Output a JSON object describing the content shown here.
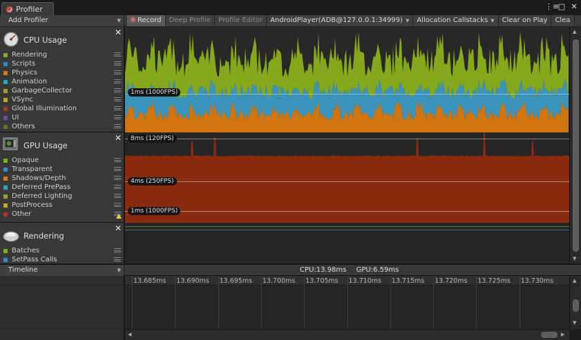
{
  "window": {
    "tab_title": "Profiler",
    "controls": [
      "⋮≡",
      "□",
      "✕"
    ]
  },
  "toolbar": {
    "add_profiler": "Add Profiler",
    "record": "Record",
    "deep_profile": "Deep Profile",
    "profiler_editor": "Profile Editor",
    "target": "AndroidPlayer(ADB@127.0.0.1:34999)",
    "allocation_callstacks": "Allocation Callstacks",
    "clear_on_play": "Clear on Play",
    "clear": "Clea"
  },
  "modules": {
    "cpu": {
      "title": "CPU Usage",
      "items": [
        {
          "label": "Rendering",
          "color": "#7ab317"
        },
        {
          "label": "Scripts",
          "color": "#2a8fc2"
        },
        {
          "label": "Physics",
          "color": "#d67b16"
        },
        {
          "label": "Animation",
          "color": "#2fa3c4"
        },
        {
          "label": "GarbageCollector",
          "color": "#9aa030"
        },
        {
          "label": "VSync",
          "color": "#c4a51d"
        },
        {
          "label": "Global Illumination",
          "color": "#b0391e"
        },
        {
          "label": "UI",
          "color": "#6a4fa0"
        },
        {
          "label": "Others",
          "color": "#6e6e2a"
        }
      ]
    },
    "gpu": {
      "title": "GPU Usage",
      "items": [
        {
          "label": "Opaque",
          "color": "#7ab317"
        },
        {
          "label": "Transparent",
          "color": "#2a8fc2"
        },
        {
          "label": "Shadows/Depth",
          "color": "#d67b16"
        },
        {
          "label": "Deferred PrePass",
          "color": "#2fa3c4"
        },
        {
          "label": "Deferred Lighting",
          "color": "#9aa030"
        },
        {
          "label": "PostProcess",
          "color": "#c4a51d"
        },
        {
          "label": "Other",
          "color": "#b0391e"
        }
      ]
    },
    "rendering": {
      "title": "Rendering",
      "items": [
        {
          "label": "Batches",
          "color": "#7ab317"
        },
        {
          "label": "SetPass Calls",
          "color": "#2a8fc2"
        }
      ]
    }
  },
  "cpu_chart": {
    "fps_label": "1ms (1000FPS)",
    "colors": {
      "rendering": "#86a81c",
      "scripts": "#3a94bb",
      "physics": "#d1750f"
    }
  },
  "gpu_chart": {
    "fps_labels": [
      "8ms (120FPS)",
      "4ms (250FPS)",
      "1ms (1000FPS)"
    ],
    "colors": {
      "other": "#8a2a0e"
    }
  },
  "detail": {
    "view": "Timeline",
    "cpu_stat": "CPU:13.98ms",
    "gpu_stat": "GPU:6.59ms"
  },
  "timeline": {
    "ticks": [
      "13.685ms",
      "13.690ms",
      "13.695ms",
      "13.700ms",
      "13.705ms",
      "13.710ms",
      "13.715ms",
      "13.720ms",
      "13.725ms",
      "13.730ms"
    ]
  }
}
